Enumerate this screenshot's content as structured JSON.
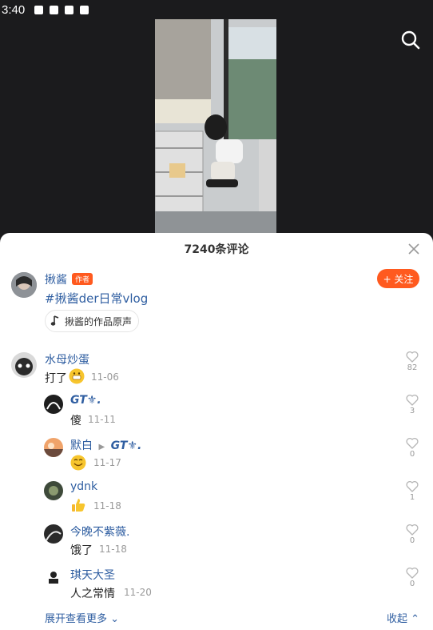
{
  "status_bar": {
    "time": "3:40"
  },
  "sheet": {
    "comment_count": "7240条评论"
  },
  "author": {
    "name": "揪酱",
    "badge": "作者",
    "follow_label": "+ 关注",
    "hashtag": "#揪酱der日常vlog",
    "music": "揪酱的作品原声"
  },
  "comment": {
    "user": "水母炒蛋",
    "text": "打了",
    "emoji": "grinning-emoji",
    "date": "11-06",
    "likes": "82"
  },
  "replies": [
    {
      "user": "GT⚜.",
      "text": "傻",
      "date": "11-11",
      "likes": "3"
    },
    {
      "user": "默白",
      "reply_to": "GT⚜.",
      "text": "",
      "emoji": "smiling-emoji",
      "date": "11-17",
      "likes": "0"
    },
    {
      "user": "ydnk",
      "text": "",
      "emoji": "thumbs-up-emoji",
      "date": "11-18",
      "likes": "1"
    },
    {
      "user": "今晚不紫薇.",
      "text": "饿了",
      "date": "11-18",
      "likes": "0"
    },
    {
      "user": "琪天大圣",
      "text": "人之常情",
      "date": "11-20",
      "likes": "0"
    }
  ],
  "footer": {
    "expand": "展开查看更多",
    "collapse": "收起"
  }
}
